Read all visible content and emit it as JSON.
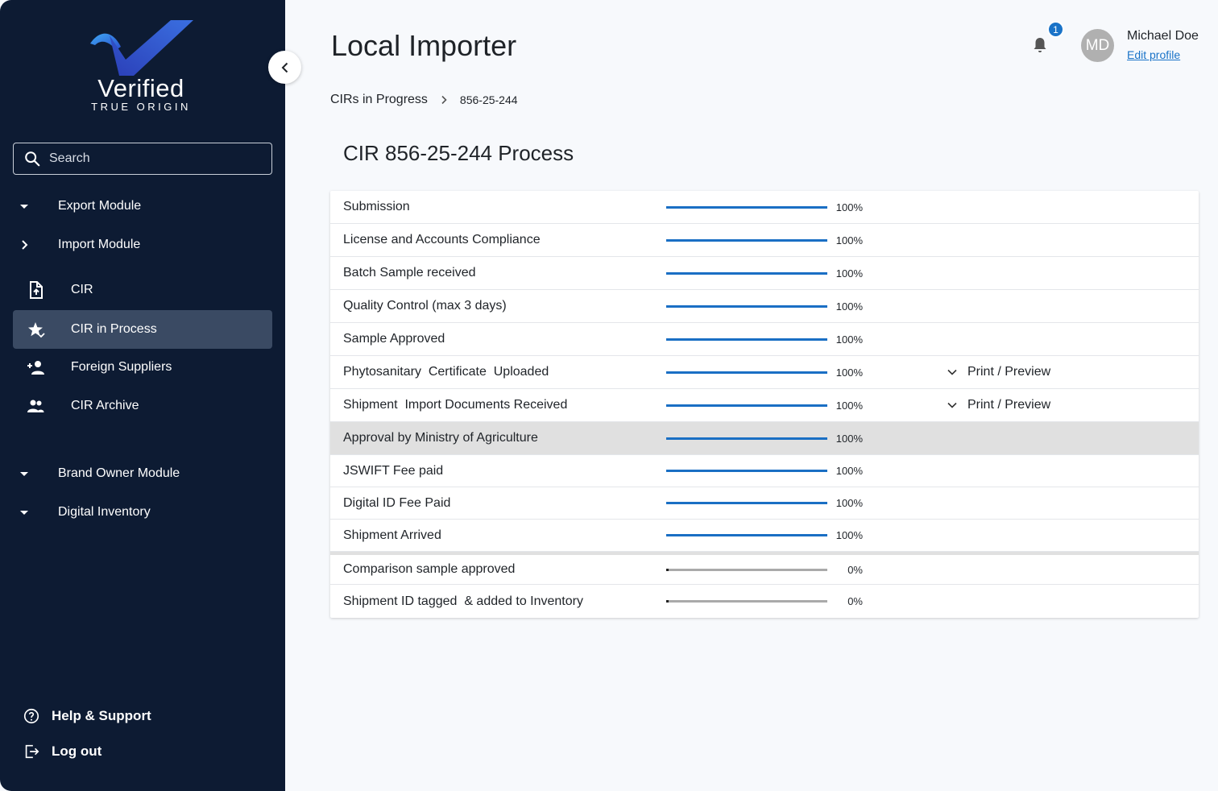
{
  "brand": {
    "word": "Verified",
    "tagline": "TRUE ORIGIN"
  },
  "search": {
    "placeholder": "Search"
  },
  "nav": {
    "export_module": "Export Module",
    "import_module": "Import Module",
    "import_items": [
      {
        "label": "CIR",
        "icon": "file-upload-icon"
      },
      {
        "label": "CIR in Process",
        "icon": "star-check-icon",
        "active": true
      },
      {
        "label": "Foreign Suppliers",
        "icon": "person-add-icon"
      },
      {
        "label": "CIR Archive",
        "icon": "people-icon"
      }
    ],
    "brand_owner_module": "Brand Owner Module",
    "digital_inventory": "Digital Inventory"
  },
  "footer": {
    "help": "Help & Support",
    "logout": "Log out"
  },
  "header": {
    "title": "Local Importer",
    "notifications_count": "1",
    "user": {
      "initials": "MD",
      "name": "Michael Doe",
      "edit_profile": "Edit profile"
    }
  },
  "breadcrumb": {
    "parent": "CIRs in Progress",
    "current": "856-25-244"
  },
  "section": {
    "title": "CIR 856-25-244 Process"
  },
  "colors": {
    "sidebar": "#0d1b33",
    "accent": "#1a6fc4",
    "active_nav": "#3a4a63",
    "highlight_row": "#e0e0e0"
  },
  "steps": [
    {
      "name": "Submission",
      "progress": 100,
      "pct_label": "100%"
    },
    {
      "name": "License and Accounts Compliance",
      "progress": 100,
      "pct_label": "100%"
    },
    {
      "name": "Batch Sample received",
      "progress": 100,
      "pct_label": "100%"
    },
    {
      "name": "Quality Control (max 3 days)",
      "progress": 100,
      "pct_label": "100%"
    },
    {
      "name": "Sample Approved",
      "progress": 100,
      "pct_label": "100%"
    },
    {
      "name": "Phytosanitary  Certificate  Uploaded",
      "progress": 100,
      "pct_label": "100%",
      "action": "Print / Preview"
    },
    {
      "name": "Shipment  Import Documents Received",
      "progress": 100,
      "pct_label": "100%",
      "action": "Print / Preview"
    },
    {
      "name": "Approval by Ministry of Agriculture",
      "progress": 100,
      "pct_label": "100%",
      "highlighted": true
    },
    {
      "name": "JSWIFT Fee paid",
      "progress": 100,
      "pct_label": "100%"
    },
    {
      "name": "Digital ID Fee Paid",
      "progress": 100,
      "pct_label": "100%"
    },
    {
      "name": "Shipment Arrived",
      "progress": 100,
      "pct_label": "100%"
    },
    {
      "name": "Comparison sample approved",
      "progress": 0,
      "pct_label": "0%"
    },
    {
      "name": "Shipment ID tagged  & added to Inventory",
      "progress": 0,
      "pct_label": "0%"
    }
  ]
}
